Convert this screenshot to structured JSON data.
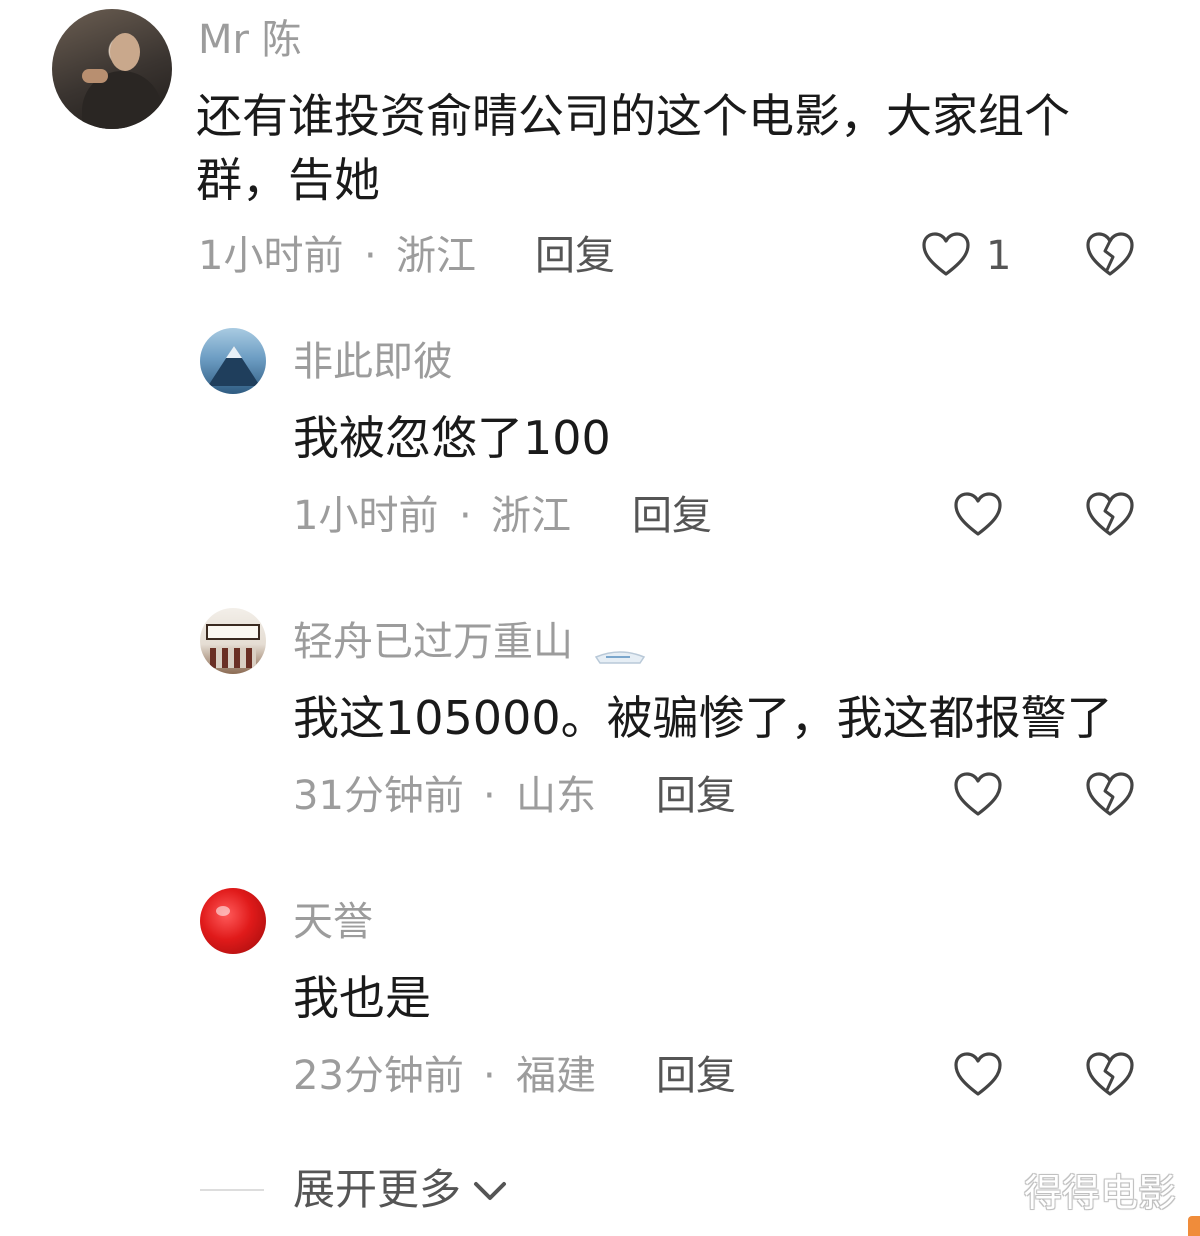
{
  "comments": [
    {
      "username": "Mr 陈",
      "text_line1": "还有谁投资俞晴公司的这个电影，大家组个",
      "text_line2": "群，告她",
      "time": "1小时前",
      "location": "浙江",
      "reply": "回复",
      "like_count": "1"
    },
    {
      "username": "非此即彼",
      "text": "我被忽悠了100",
      "time": "1小时前",
      "location": "浙江",
      "reply": "回复"
    },
    {
      "username": "轻舟已过万重山",
      "text": "我这105000。被骗惨了，我这都报警了",
      "time": "31分钟前",
      "location": "山东",
      "reply": "回复"
    },
    {
      "username": "天誉",
      "text": "我也是",
      "time": "23分钟前",
      "location": "福建",
      "reply": "回复"
    }
  ],
  "separator": "·",
  "expand_label": "展开更多",
  "watermark": "得得电影",
  "icons": {
    "like": "heart-outline-icon",
    "dislike": "broken-heart-icon",
    "expand": "chevron-down-icon"
  },
  "colors": {
    "text_primary": "#1a1a1a",
    "text_secondary": "#9c9c9c",
    "reply": "#555555"
  }
}
